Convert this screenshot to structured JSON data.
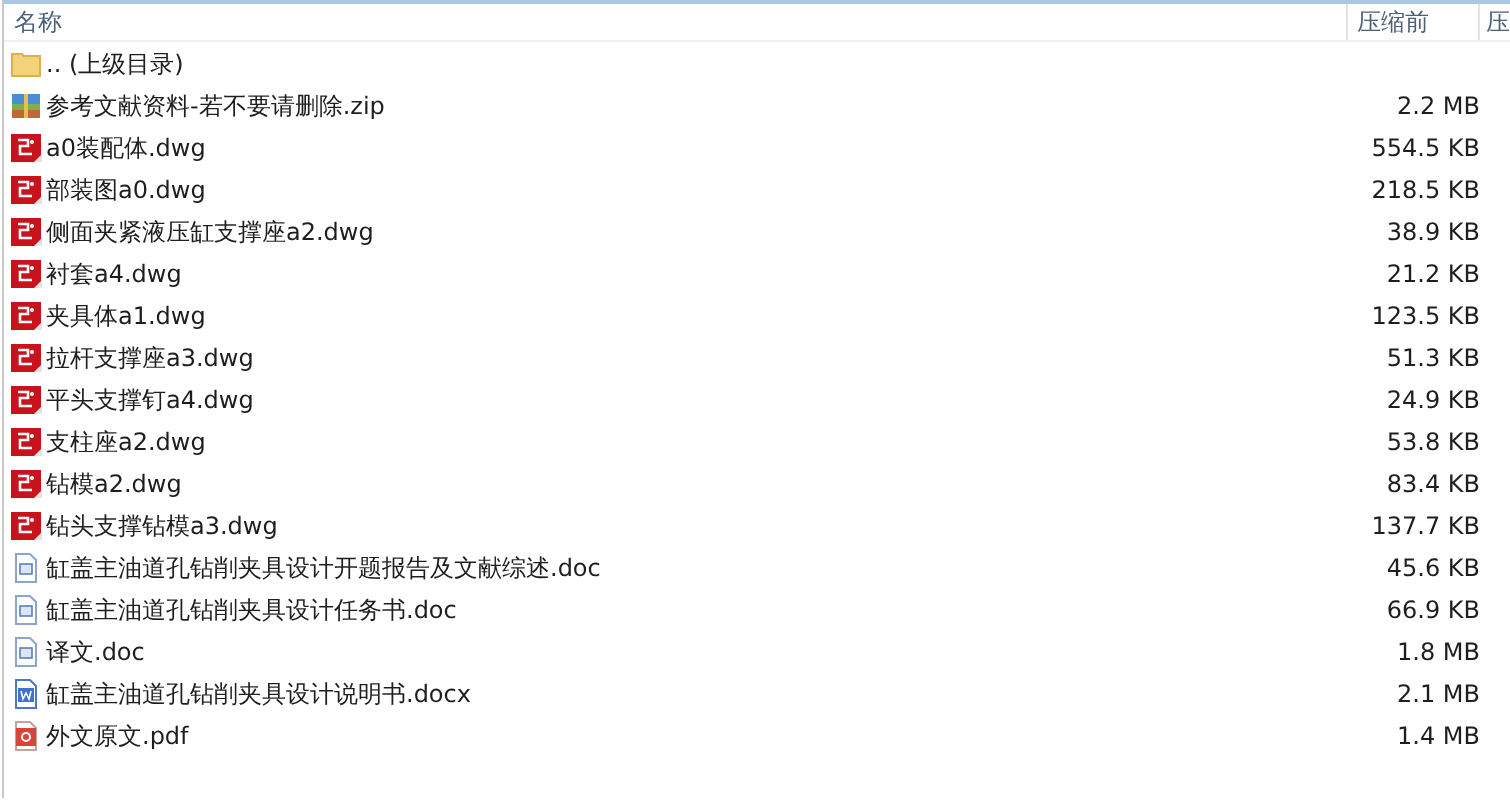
{
  "columns": [
    "名称",
    "压缩前",
    "压"
  ],
  "rows": [
    {
      "kind": "folder",
      "name": ".. (上级目录)",
      "size": ""
    },
    {
      "kind": "zip",
      "name": "参考文献资料-若不要请删除.zip",
      "size": "2.2 MB"
    },
    {
      "kind": "dwg",
      "name": "a0装配体.dwg",
      "size": "554.5 KB"
    },
    {
      "kind": "dwg",
      "name": "部装图a0.dwg",
      "size": "218.5 KB"
    },
    {
      "kind": "dwg",
      "name": "侧面夹紧液压缸支撑座a2.dwg",
      "size": "38.9 KB"
    },
    {
      "kind": "dwg",
      "name": "衬套a4.dwg",
      "size": "21.2 KB"
    },
    {
      "kind": "dwg",
      "name": "夹具体a1.dwg",
      "size": "123.5 KB"
    },
    {
      "kind": "dwg",
      "name": "拉杆支撑座a3.dwg",
      "size": "51.3 KB"
    },
    {
      "kind": "dwg",
      "name": "平头支撑钉a4.dwg",
      "size": "24.9 KB"
    },
    {
      "kind": "dwg",
      "name": "支柱座a2.dwg",
      "size": "53.8 KB"
    },
    {
      "kind": "dwg",
      "name": "钻模a2.dwg",
      "size": "83.4 KB"
    },
    {
      "kind": "dwg",
      "name": "钻头支撑钻模a3.dwg",
      "size": "137.7 KB"
    },
    {
      "kind": "doc",
      "name": "缸盖主油道孔钻削夹具设计开题报告及文献综述.doc",
      "size": "45.6 KB"
    },
    {
      "kind": "doc",
      "name": "缸盖主油道孔钻削夹具设计任务书.doc",
      "size": "66.9 KB"
    },
    {
      "kind": "doc",
      "name": "译文.doc",
      "size": "1.8 MB"
    },
    {
      "kind": "docx",
      "name": "缸盖主油道孔钻削夹具设计说明书.docx",
      "size": "2.1 MB"
    },
    {
      "kind": "pdf",
      "name": "外文原文.pdf",
      "size": "1.4 MB"
    }
  ]
}
